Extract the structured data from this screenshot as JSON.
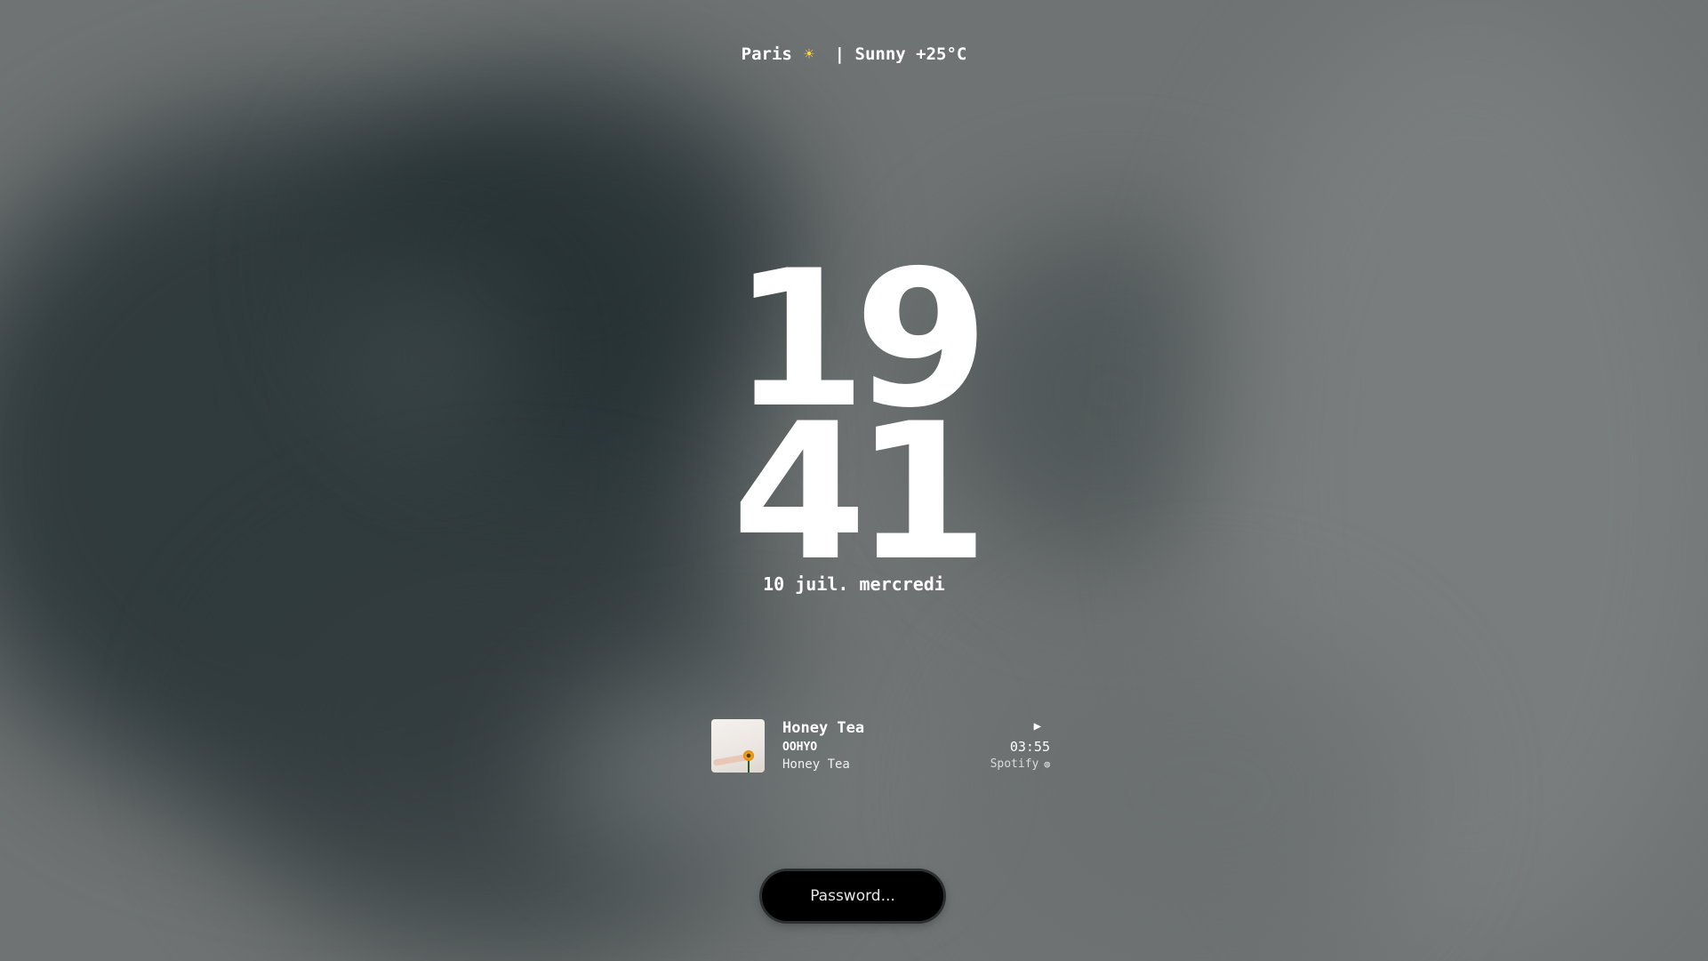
{
  "weather": {
    "city": "Paris",
    "icon": "sun-icon",
    "separator": " | ",
    "condition": "Sunny +25°C"
  },
  "clock": {
    "hours": "19",
    "minutes": "41"
  },
  "date": "10 juil. mercredi",
  "media": {
    "title": "Honey Tea",
    "artist": "OOHYO",
    "album": "Honey Tea",
    "play_symbol": "▶",
    "duration": "03:55",
    "source": "Spotify",
    "source_icon": "spotify-icon"
  },
  "password": {
    "placeholder": "Password..."
  }
}
